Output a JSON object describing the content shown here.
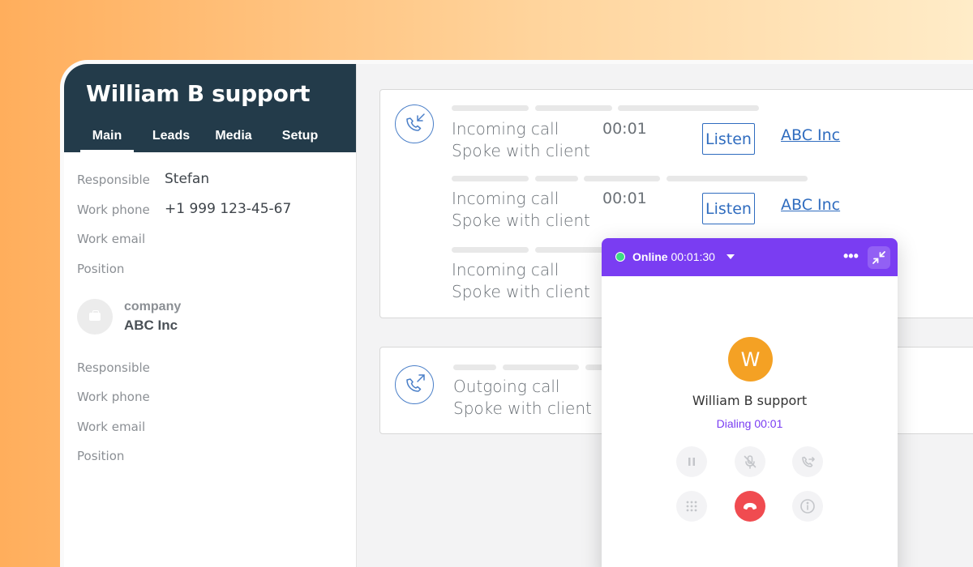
{
  "panel": {
    "title": "William B support",
    "tabs": [
      "Main",
      "Leads",
      "Media",
      "Setup"
    ],
    "contact_fields": [
      {
        "label": "Responsible",
        "value": "Stefan"
      },
      {
        "label": "Work phone",
        "value": "+1 999 123-45-67"
      },
      {
        "label": "Work email",
        "value": ""
      },
      {
        "label": "Position",
        "value": ""
      }
    ],
    "company": {
      "type_label": "company",
      "name": "ABC Inc",
      "fields": [
        {
          "label": "Responsible",
          "value": ""
        },
        {
          "label": "Work phone",
          "value": ""
        },
        {
          "label": "Work email",
          "value": ""
        },
        {
          "label": "Position",
          "value": ""
        }
      ]
    }
  },
  "calls": [
    {
      "type": "Incoming call",
      "note": "Spoke with client",
      "duration": "00:01",
      "action": "Listen",
      "company": "ABC Inc"
    },
    {
      "type": "Incoming call",
      "note": "Spoke with client",
      "duration": "00:01",
      "action": "Listen",
      "company": "ABC Inc"
    },
    {
      "type": "Incoming call",
      "note": "Spoke with client"
    },
    {
      "type": "Outgoing call",
      "note": "Spoke with client"
    }
  ],
  "softphone": {
    "status": "Online",
    "timer": "00:01:30",
    "more": "•••",
    "avatar_initial": "W",
    "contact_name": "William B support",
    "dialing": "Dialing 00:01",
    "colors": {
      "header": "#7a3df2",
      "online": "#3ddc84",
      "avatar": "#f4a124",
      "hangup": "#f04b50"
    },
    "controls": [
      "pause-icon",
      "mute-icon",
      "transfer-icon",
      "keypad-icon",
      "hangup-icon",
      "info-icon"
    ]
  },
  "colors": {
    "panel_header": "#233b4a",
    "link": "#2f6cbf",
    "call_icon": "#4a7fc8"
  }
}
